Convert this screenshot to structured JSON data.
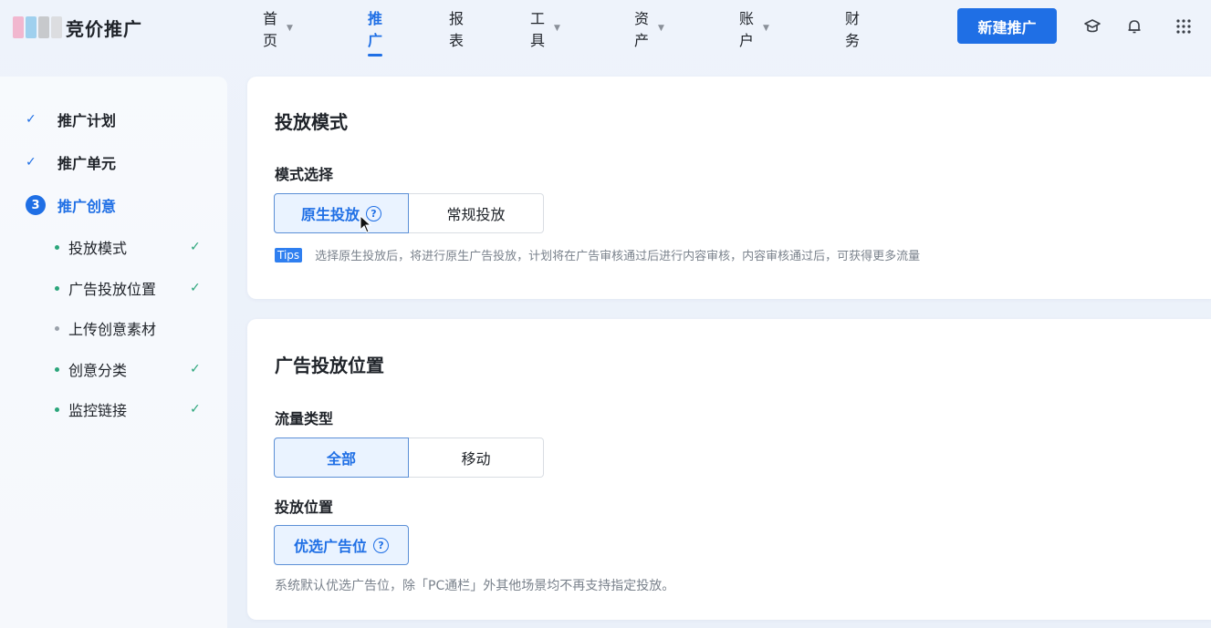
{
  "header": {
    "logo_text": "竞价推广",
    "logo_colors": [
      "#f1b7cf",
      "#9fd0ee",
      "#c7c9cc"
    ],
    "nav": [
      {
        "label": "首页",
        "caret": "▼",
        "active": false
      },
      {
        "label": "推广",
        "caret": "",
        "active": true
      },
      {
        "label": "报表",
        "caret": "",
        "active": false
      },
      {
        "label": "工具",
        "caret": "▼",
        "active": false
      },
      {
        "label": "资产",
        "caret": "▼",
        "active": false
      },
      {
        "label": "账户",
        "caret": "▼",
        "active": false
      },
      {
        "label": "财务",
        "caret": "",
        "active": false
      }
    ],
    "new_button": "新建推广",
    "icons": [
      "graduation-cap-icon",
      "bell-icon",
      "apps-grid-icon"
    ]
  },
  "sidebar": {
    "steps": [
      {
        "marker": "✓",
        "label": "推广计划"
      },
      {
        "marker": "✓",
        "label": "推广单元"
      },
      {
        "marker": "3",
        "label": "推广创意"
      }
    ],
    "substeps": [
      {
        "label": "投放模式",
        "done": "✓"
      },
      {
        "label": "广告投放位置",
        "done": "✓"
      },
      {
        "label": "上传创意素材",
        "done": ""
      },
      {
        "label": "创意分类",
        "done": "✓"
      },
      {
        "label": "监控链接",
        "done": "✓"
      }
    ]
  },
  "mode_card": {
    "title": "投放模式",
    "field_label": "模式选择",
    "options": [
      "原生投放",
      "常规投放"
    ],
    "help_glyph": "?",
    "tips_badge": "Tips",
    "tips_text": "选择原生投放后，将进行原生广告投放，计划将在广告审核通过后进行内容审核，内容审核通过后，可获得更多流量"
  },
  "placement_card": {
    "title": "广告投放位置",
    "traffic_label": "流量类型",
    "traffic_options": [
      "全部",
      "移动"
    ],
    "position_label": "投放位置",
    "position_option": "优选广告位",
    "help_glyph": "?",
    "note": "系统默认优选广告位，除「PC通栏」外其他场景均不再支持指定投放。"
  },
  "colors": {
    "accent": "#1f6fe5",
    "success": "#2aa57a"
  }
}
